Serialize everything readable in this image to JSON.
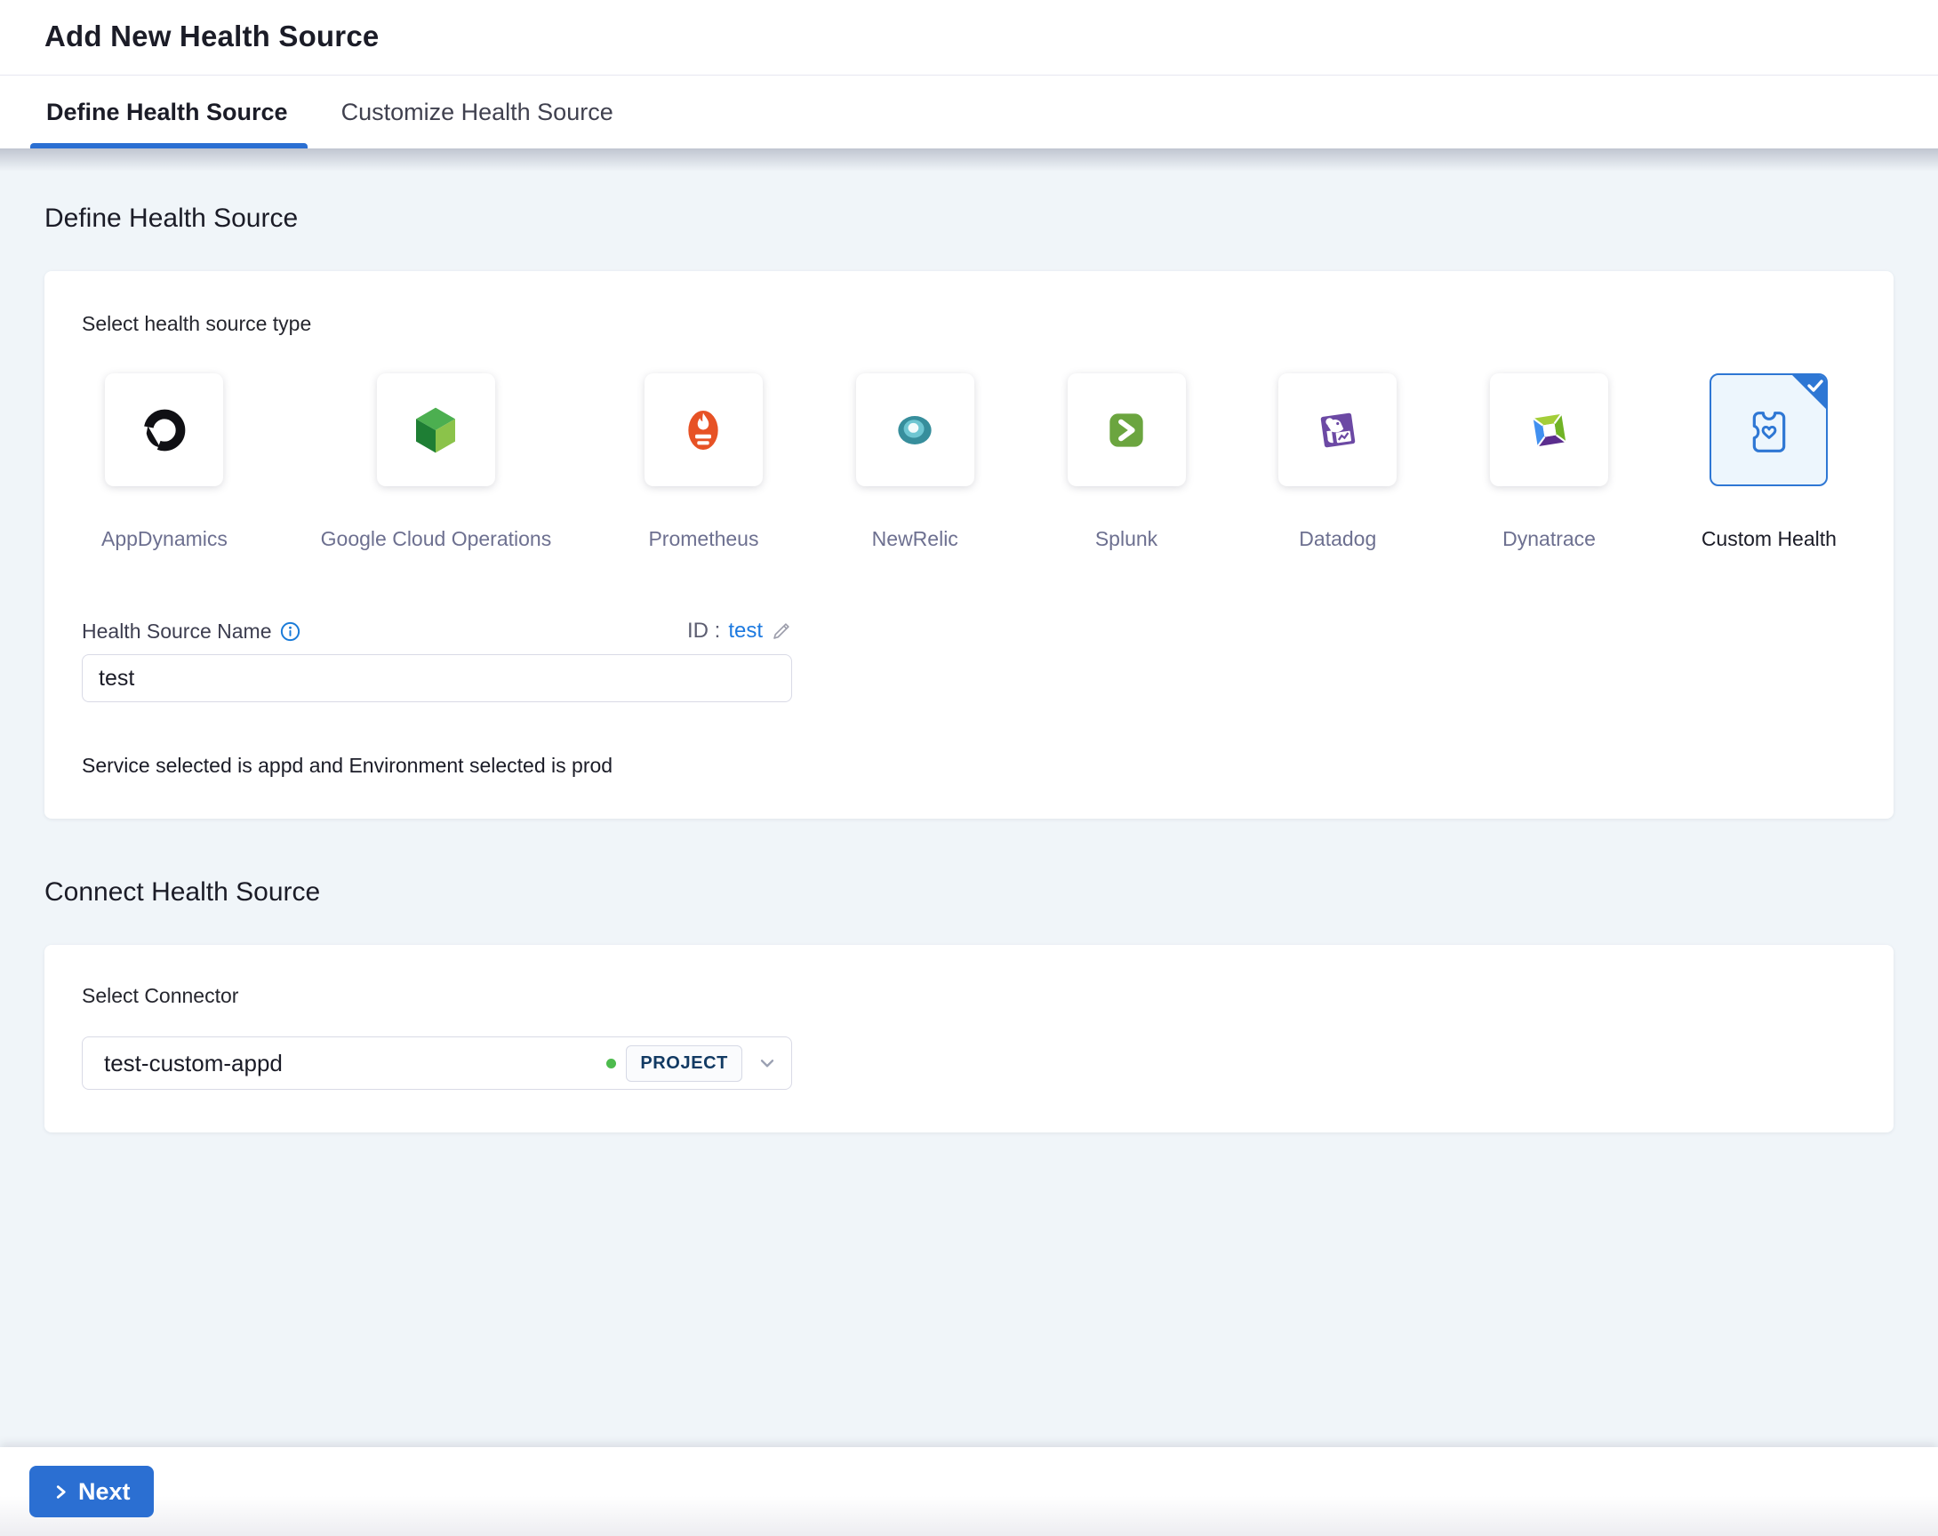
{
  "header": {
    "title": "Add New Health Source",
    "tabs": [
      {
        "label": "Define Health Source",
        "active": true
      },
      {
        "label": "Customize Health Source",
        "active": false
      }
    ]
  },
  "define": {
    "heading": "Define Health Source",
    "type_label": "Select health source type",
    "sources": [
      {
        "name": "AppDynamics",
        "icon": "appdynamics-logo",
        "selected": false
      },
      {
        "name": "Google Cloud Operations",
        "icon": "google-cloud-operations-logo",
        "selected": false
      },
      {
        "name": "Prometheus",
        "icon": "prometheus-logo",
        "selected": false
      },
      {
        "name": "NewRelic",
        "icon": "newrelic-logo",
        "selected": false
      },
      {
        "name": "Splunk",
        "icon": "splunk-logo",
        "selected": false
      },
      {
        "name": "Datadog",
        "icon": "datadog-logo",
        "selected": false
      },
      {
        "name": "Dynatrace",
        "icon": "dynatrace-logo",
        "selected": false
      },
      {
        "name": "Custom Health",
        "icon": "custom-health-logo",
        "selected": true
      }
    ],
    "name_field": {
      "label": "Health Source Name",
      "info_icon": "info-icon",
      "id_prefix": "ID :",
      "id_value": "test",
      "edit_icon": "edit-pencil-icon",
      "value": "test"
    },
    "note": "Service selected is appd and Environment selected is prod"
  },
  "connect": {
    "heading": "Connect Health Source",
    "connector_label": "Select Connector",
    "connector": {
      "value": "test-custom-appd",
      "scope_badge": "PROJECT",
      "status_dot_color": "#4dbb4d",
      "chevron_icon": "chevron-down-icon"
    }
  },
  "footer": {
    "next_label": "Next",
    "next_icon": "chevron-right-icon"
  },
  "colors": {
    "primary_blue": "#2b6fd2",
    "link_blue": "#1e7ae0",
    "selected_card_bg": "#edf6fd",
    "selected_card_border": "#2e77d4",
    "page_background": "#f0f5f9",
    "source_label_gray": "#6d7090",
    "badge_text_navy": "#123a63",
    "status_green": "#4dbb4d"
  }
}
